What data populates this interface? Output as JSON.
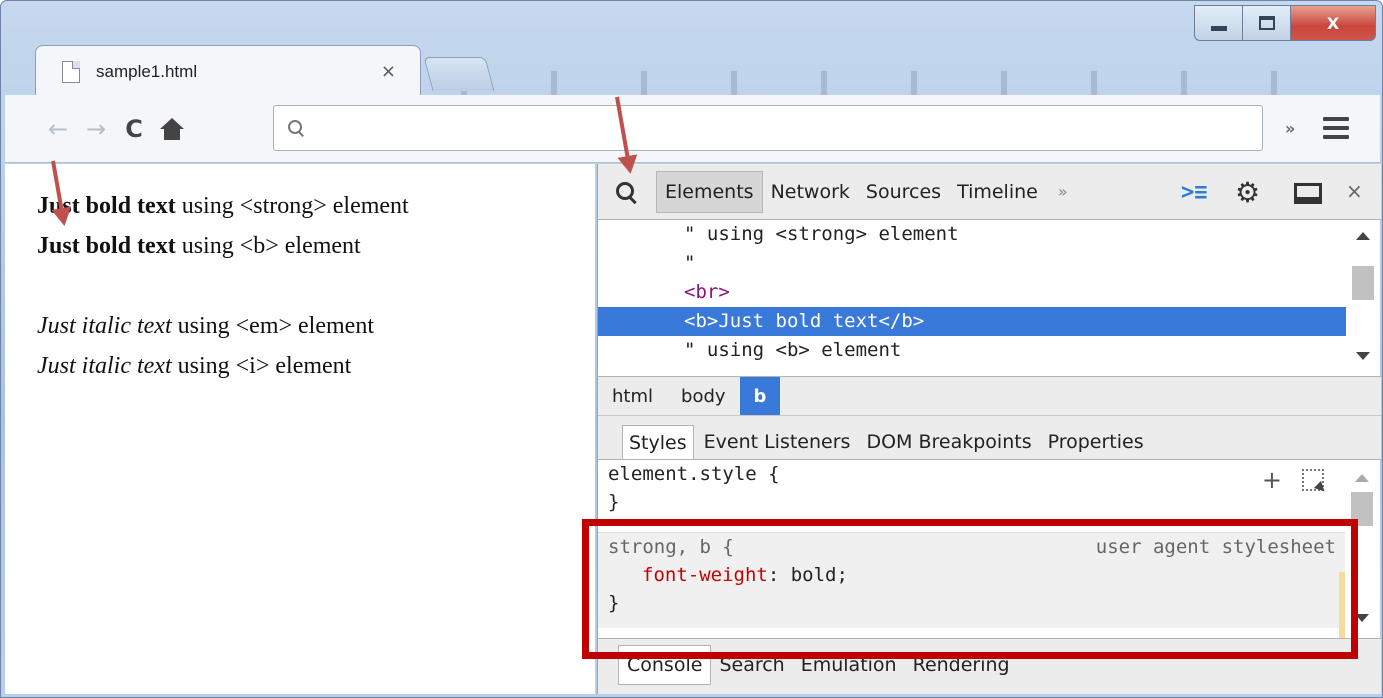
{
  "window": {
    "controls": {
      "minimize": "",
      "maximize": "",
      "close": "X"
    }
  },
  "browser": {
    "tab_title": "sample1.html",
    "tab_close": "×",
    "address_value": "",
    "nav": {
      "back": "←",
      "forward": "→",
      "reload": "C"
    },
    "overflow_chevron": "»"
  },
  "page": {
    "lines": [
      {
        "bold": "Just bold text",
        "rest": " using <strong> element"
      },
      {
        "bold": "Just bold text",
        "rest": " using <b> element"
      },
      {
        "italic": "Just italic text",
        "rest": " using <em> element"
      },
      {
        "italic": "Just italic text",
        "rest": " using <i> element"
      }
    ]
  },
  "devtools": {
    "tabs": [
      "Elements",
      "Network",
      "Sources",
      "Timeline"
    ],
    "more": "»",
    "close": "×",
    "dom_lines": [
      "\" using <strong> element",
      "\"",
      "<br>",
      "<b>Just bold text</b>",
      "\" using <b> element"
    ],
    "breadcrumb": [
      "html",
      "body",
      "b"
    ],
    "sidebar_tabs": [
      "Styles",
      "Event Listeners",
      "DOM Breakpoints",
      "Properties"
    ],
    "styles": {
      "element_style_open": "element.style {",
      "element_style_close": "}",
      "add_rule": "+",
      "ua_selector": "strong, b {",
      "ua_origin": "user agent stylesheet",
      "ua_property": "font-weight",
      "ua_value": " bold;",
      "ua_close": "}"
    },
    "drawer_tabs": [
      "Console",
      "Search",
      "Emulation",
      "Rendering"
    ]
  }
}
